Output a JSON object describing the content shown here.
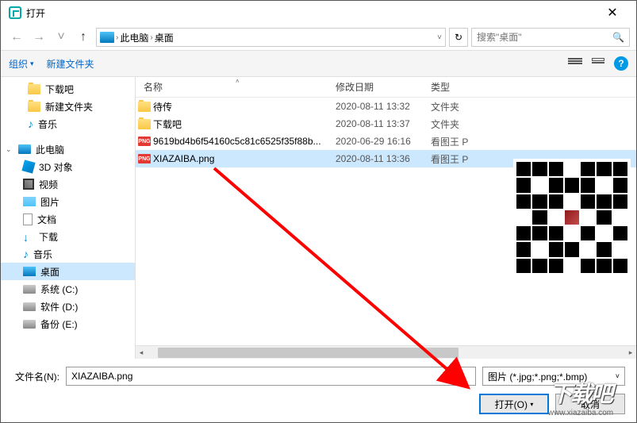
{
  "titlebar": {
    "title": "打开"
  },
  "nav": {
    "breadcrumb": {
      "root": "此电脑",
      "current": "桌面"
    },
    "search_placeholder": "搜索\"桌面\""
  },
  "toolbar": {
    "organize": "组织",
    "newfolder": "新建文件夹"
  },
  "sidebar": {
    "items": [
      {
        "label": "下载吧",
        "icon": "folder"
      },
      {
        "label": "新建文件夹",
        "icon": "folder"
      },
      {
        "label": "音乐",
        "icon": "music"
      }
    ],
    "pc_label": "此电脑",
    "pc_items": [
      {
        "label": "3D 对象",
        "icon": "obj3d"
      },
      {
        "label": "视频",
        "icon": "video"
      },
      {
        "label": "图片",
        "icon": "pic"
      },
      {
        "label": "文档",
        "icon": "doc"
      },
      {
        "label": "下载",
        "icon": "dl"
      },
      {
        "label": "音乐",
        "icon": "music"
      },
      {
        "label": "桌面",
        "icon": "desk",
        "active": true
      },
      {
        "label": "系统 (C:)",
        "icon": "drive"
      },
      {
        "label": "软件 (D:)",
        "icon": "drive"
      },
      {
        "label": "备份 (E:)",
        "icon": "drive"
      }
    ]
  },
  "columns": {
    "name": "名称",
    "date": "修改日期",
    "type": "类型"
  },
  "files": [
    {
      "name": "待传",
      "date": "2020-08-11 13:32",
      "type": "文件夹",
      "icon": "folder"
    },
    {
      "name": "下载吧",
      "date": "2020-08-11 13:37",
      "type": "文件夹",
      "icon": "folder"
    },
    {
      "name": "9619bd4b6f54160c5c81c6525f35f88b...",
      "date": "2020-06-29 16:16",
      "type": "看图王 P",
      "icon": "png"
    },
    {
      "name": "XIAZAIBA.png",
      "date": "2020-08-11 13:36",
      "type": "看图王 P",
      "icon": "png",
      "selected": true
    }
  ],
  "bottom": {
    "filename_label": "文件名(N):",
    "filename_value": "XIAZAIBA.png",
    "filter": "图片 (*.jpg;*.png;*.bmp)",
    "open": "打开(O)",
    "cancel": "取消"
  },
  "watermark": {
    "logo": "下载吧",
    "url": "www.xiazaiba.com"
  }
}
